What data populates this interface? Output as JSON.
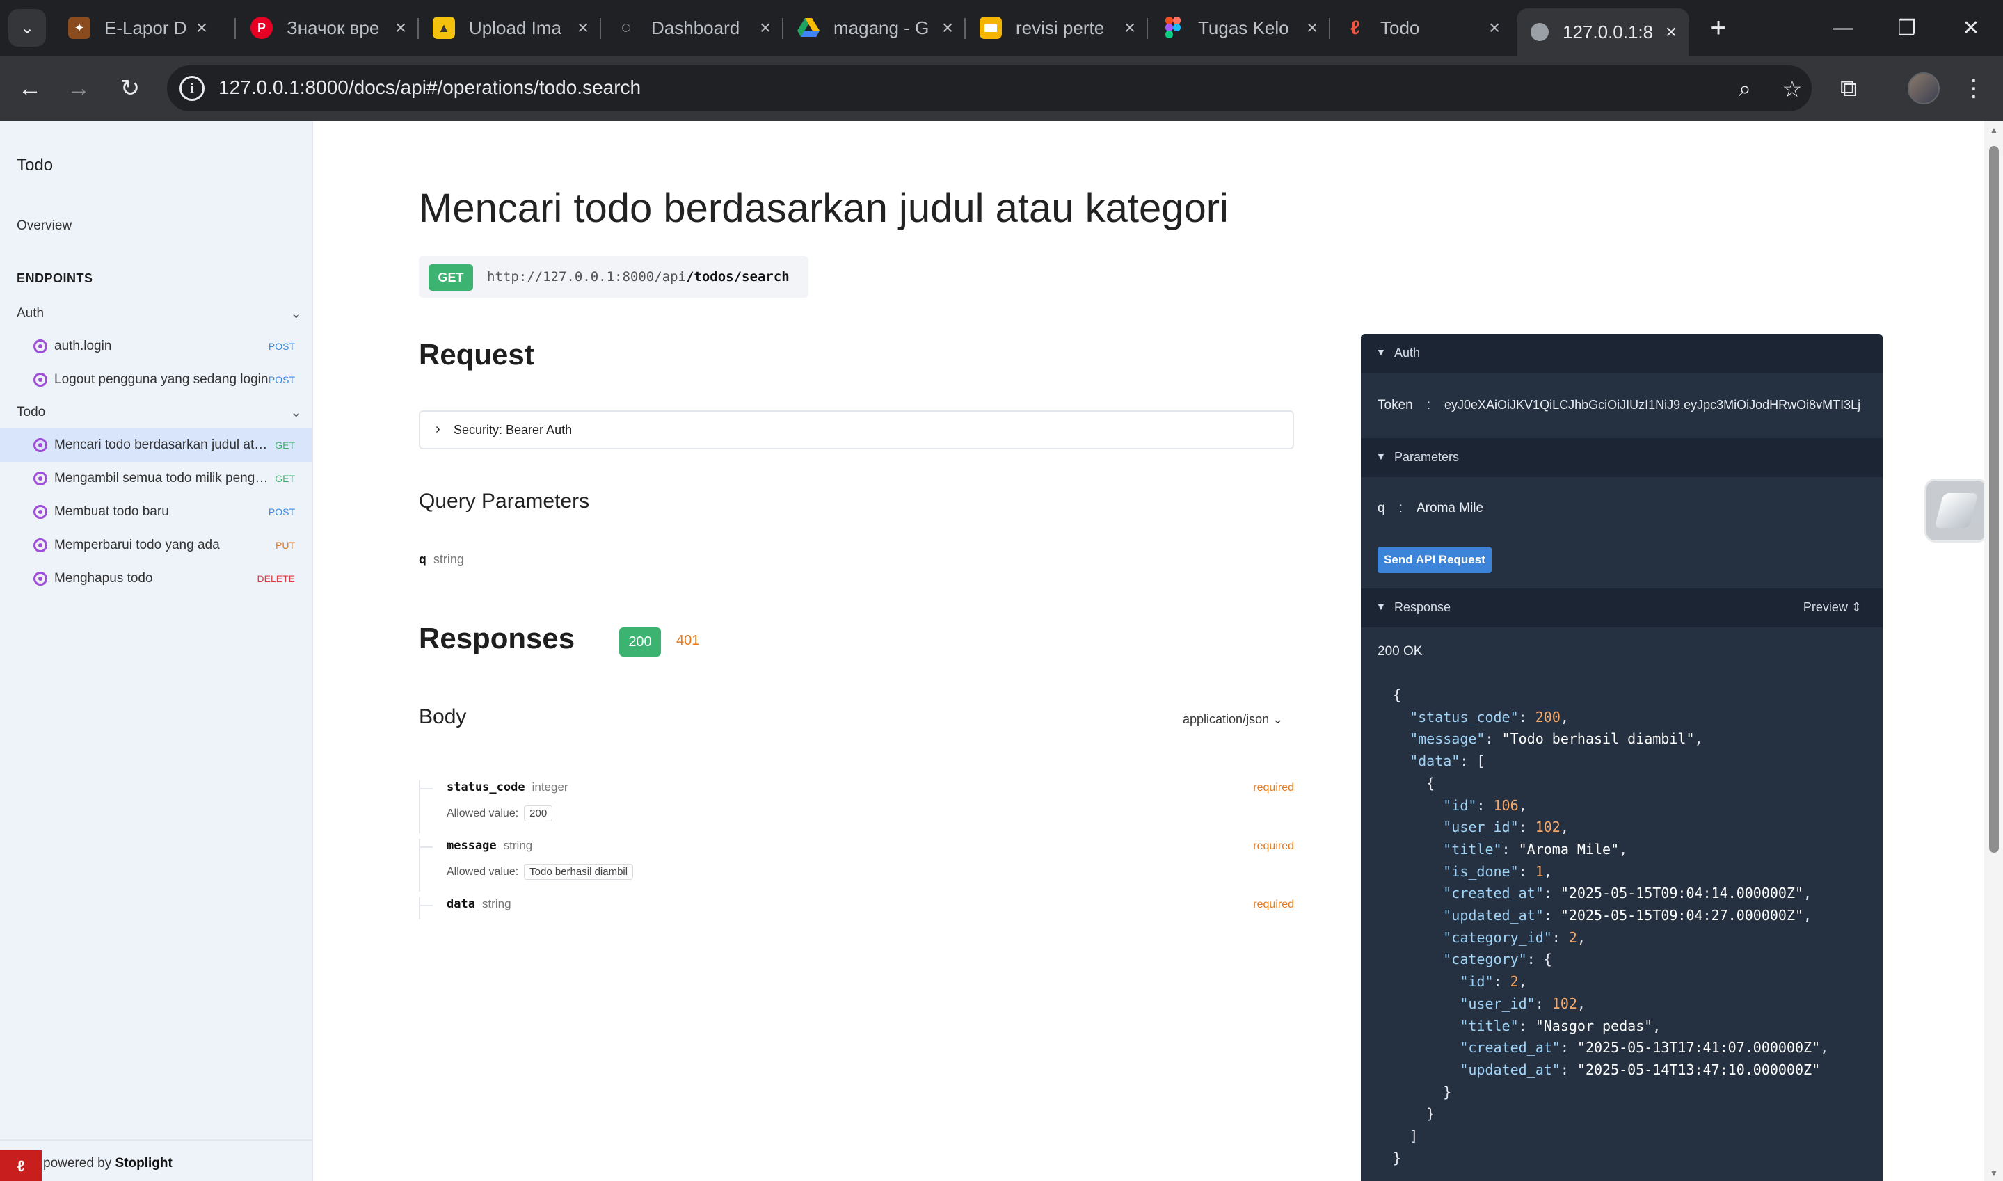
{
  "browser": {
    "tabs": [
      {
        "title": "E-Lapor DIY",
        "favicon": "crest-icon",
        "color": "#8a4b1e"
      },
      {
        "title": "Значок вре",
        "favicon": "pinterest-icon",
        "color": "#e60023"
      },
      {
        "title": "Upload Ima",
        "favicon": "upload-icon",
        "color": "#f4c20d"
      },
      {
        "title": "Dashboard",
        "favicon": "dashboard-icon",
        "color": "#202124"
      },
      {
        "title": "magang - G",
        "favicon": "google-drive-icon",
        "color": "#1fa463"
      },
      {
        "title": "revisi perte",
        "favicon": "slides-icon",
        "color": "#f4b400"
      },
      {
        "title": "Tugas Kelo",
        "favicon": "figma-icon",
        "color": "#a259ff"
      },
      {
        "title": "Todo",
        "favicon": "laravel-icon",
        "color": "#f05340"
      },
      {
        "title": "127.0.0.1:8",
        "favicon": "globe-icon",
        "color": "#9aa0a6"
      }
    ],
    "active_tab_index": 8,
    "url": "127.0.0.1:8000/docs/api#/operations/todo.search"
  },
  "sidebar": {
    "title": "Todo",
    "overview": "Overview",
    "endpoints_heading": "ENDPOINTS",
    "groups": [
      {
        "name": "Auth",
        "items": [
          {
            "label": "auth.login",
            "verb": "POST"
          },
          {
            "label": "Logout pengguna yang sedang login",
            "verb": "POST"
          }
        ]
      },
      {
        "name": "Todo",
        "items": [
          {
            "label": "Mencari todo berdasarkan judul atau kategori",
            "verb": "GET",
            "active": true
          },
          {
            "label": "Mengambil semua todo milik pengguna",
            "verb": "GET"
          },
          {
            "label": "Membuat todo baru",
            "verb": "POST"
          },
          {
            "label": "Memperbarui todo yang ada",
            "verb": "PUT"
          },
          {
            "label": "Menghapus todo",
            "verb": "DELETE"
          }
        ]
      }
    ],
    "footer_prefix": "powered by",
    "footer_brand": "Stoplight"
  },
  "main": {
    "title": "Mencari todo berdasarkan judul atau kategori",
    "method": "GET",
    "endpoint_base": "http://127.0.0.1:8000/api",
    "endpoint_path": "/todos/search",
    "request_heading": "Request",
    "security_label": "Security: Bearer Auth",
    "query_heading": "Query Parameters",
    "query_param_name": "q",
    "query_param_type": "string",
    "responses_heading": "Responses",
    "response_codes": [
      "200",
      "401"
    ],
    "body_heading": "Body",
    "mime_type": "application/json",
    "allowed_value_label": "Allowed value:",
    "fields": [
      {
        "name": "status_code",
        "type": "integer",
        "required": "required",
        "allowed": "200"
      },
      {
        "name": "message",
        "type": "string",
        "required": "required",
        "allowed": "Todo berhasil diambil"
      },
      {
        "name": "data",
        "type": "string",
        "required": "required",
        "allowed": ""
      }
    ]
  },
  "panel": {
    "auth_heading": "Auth",
    "token_label": "Token",
    "token_sep": ":",
    "token_value": "eyJ0eXAiOiJKV1QiLCJhbGciOiJIUzI1NiJ9.eyJpc3MiOiJodHRwOi8vMTI3Lj",
    "params_heading": "Parameters",
    "param_name": "q",
    "param_sep": ":",
    "param_value": "Aroma Mile",
    "send_button": "Send API Request",
    "response_heading": "Response",
    "preview_label": "Preview",
    "status": "200 OK",
    "response_json": {
      "status_code": 200,
      "message": "Todo berhasil diambil",
      "data": [
        {
          "id": 106,
          "user_id": 102,
          "title": "Aroma Mile",
          "is_done": 1,
          "created_at": "2025-05-15T09:04:14.000000Z",
          "updated_at": "2025-05-15T09:04:27.000000Z",
          "category_id": 2,
          "category": {
            "id": 2,
            "user_id": 102,
            "title": "Nasgor pedas",
            "created_at": "2025-05-13T17:41:07.000000Z",
            "updated_at": "2025-05-14T13:47:10.000000Z"
          }
        }
      ]
    }
  }
}
